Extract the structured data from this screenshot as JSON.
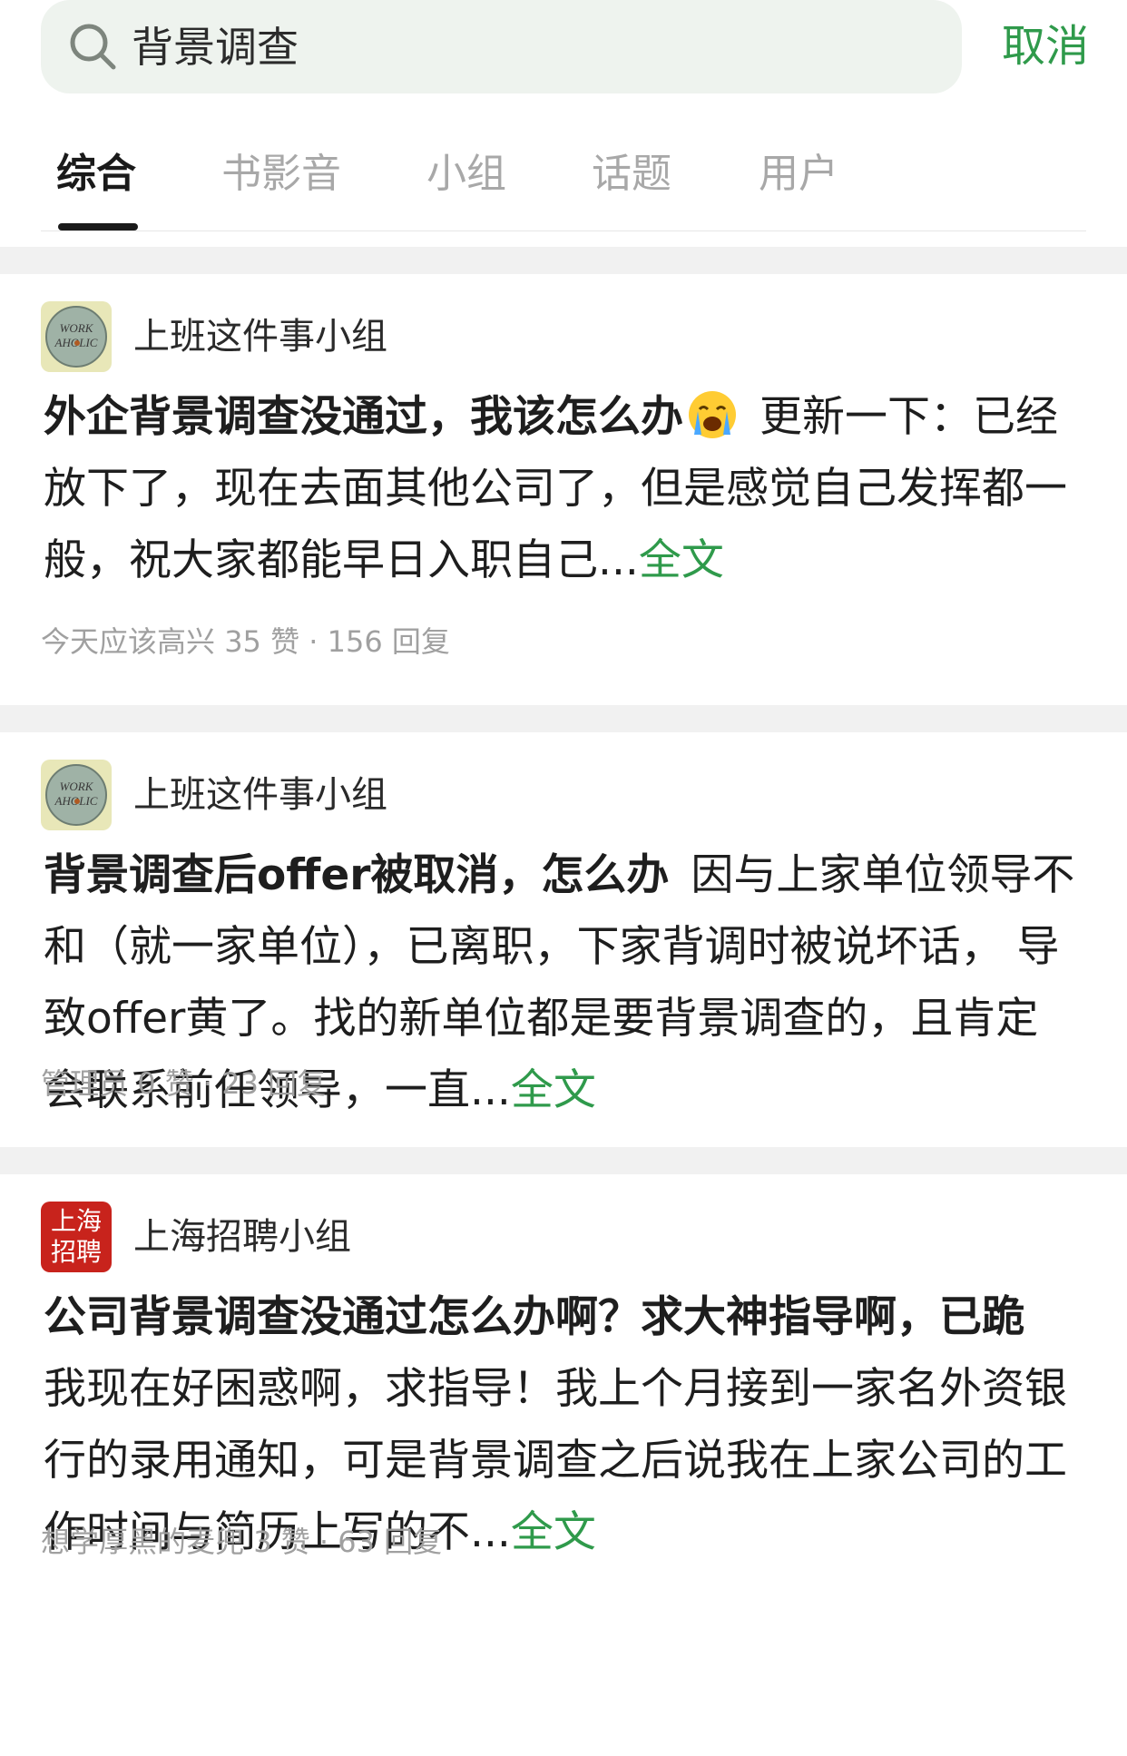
{
  "search": {
    "query": "背景调查",
    "cancel_label": "取消"
  },
  "tabs": [
    {
      "label": "综合",
      "active": true
    },
    {
      "label": "书影音",
      "active": false
    },
    {
      "label": "小组",
      "active": false
    },
    {
      "label": "话题",
      "active": false
    },
    {
      "label": "用户",
      "active": false
    }
  ],
  "accent_color": "#2f9a4b",
  "posts": [
    {
      "group": "上班这件事小组",
      "avatar_text": "WORK AHOLIC",
      "title": "外企背景调查没通过，我该怎么办",
      "title_emoji": "loudly-crying-face",
      "body": "更新一下：已经放下了，现在去面其他公司了，但是感觉自己发挥都一般，祝大家都能早日入职自己...",
      "more": "全文",
      "author": "今天应该高兴",
      "stats": "35 赞 · 156 回复"
    },
    {
      "group": "上班这件事小组",
      "avatar_text": "WORK AHOLIC",
      "title": "背景调查后offer被取消，怎么办",
      "body": "因与上家单位领导不和（就一家单位），已离职，下家背调时被说坏话， 导致offer黄了。找的新单位都是要背景调查的，且肯定会联系前任领导，一直...",
      "more": "全文",
      "author": "管理员",
      "stats": "0 赞 · 23 回复"
    },
    {
      "group": "上海招聘小组",
      "avatar_text_line1": "上海",
      "avatar_text_line2": "招聘",
      "title": "公司背景调查没通过怎么办啊？求大神指导啊，已跪",
      "body": "我现在好困惑啊，求指导！我上个月接到一家名外资银行的录用通知，可是背景调查之后说我在上家公司的工作时间与简历上写的不...",
      "more": "全文",
      "author": "想学厚黑的麦兜",
      "stats": "3 赞 · 63 回复"
    }
  ]
}
